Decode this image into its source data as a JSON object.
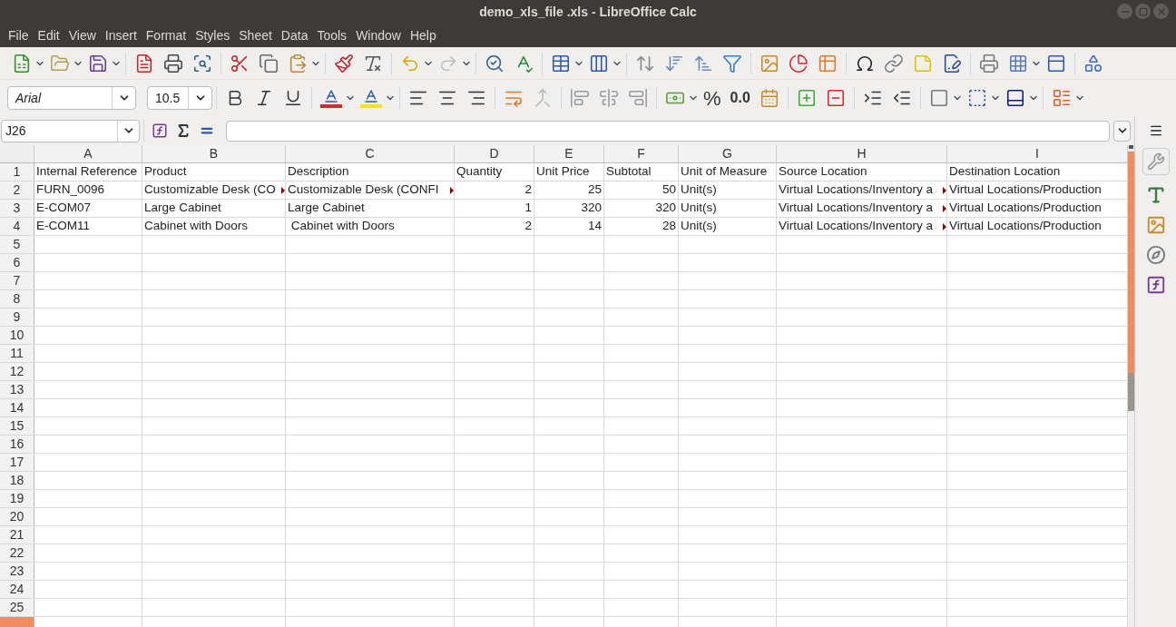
{
  "window": {
    "title": "demo_xls_file .xls - LibreOffice Calc"
  },
  "menu": [
    "File",
    "Edit",
    "View",
    "Insert",
    "Format",
    "Styles",
    "Sheet",
    "Data",
    "Tools",
    "Window",
    "Help"
  ],
  "formatting": {
    "font_name": "Arial",
    "font_size": "10.5",
    "percent_glyph": "%",
    "decimal_glyph": "0.0"
  },
  "formula_bar": {
    "name_box": "J26"
  },
  "columns": [
    "A",
    "B",
    "C",
    "D",
    "E",
    "F",
    "G",
    "H",
    "I"
  ],
  "rows": [
    {
      "number": "1",
      "selected": false,
      "cells": [
        {
          "text": "Internal Reference",
          "kind": "text",
          "clipped": false
        },
        {
          "text": "Product",
          "kind": "text",
          "clipped": false
        },
        {
          "text": "Description",
          "kind": "text",
          "clipped": false
        },
        {
          "text": "Quantity",
          "kind": "text",
          "clipped": false
        },
        {
          "text": "Unit Price",
          "kind": "text",
          "clipped": false
        },
        {
          "text": "Subtotal",
          "kind": "text",
          "clipped": false
        },
        {
          "text": "Unit of Measure",
          "kind": "text",
          "clipped": false
        },
        {
          "text": "Source Location",
          "kind": "text",
          "clipped": false
        },
        {
          "text": "Destination Location",
          "kind": "text",
          "clipped": false
        }
      ]
    },
    {
      "number": "2",
      "selected": false,
      "cells": [
        {
          "text": "FURN_0096",
          "kind": "text",
          "clipped": false
        },
        {
          "text": "Customizable Desk (CO",
          "kind": "text",
          "clipped": true
        },
        {
          "text": "Customizable Desk (CONFI",
          "kind": "text",
          "clipped": true
        },
        {
          "text": "2",
          "kind": "number",
          "clipped": false
        },
        {
          "text": "25",
          "kind": "number",
          "clipped": false
        },
        {
          "text": "50",
          "kind": "number",
          "clipped": false
        },
        {
          "text": "Unit(s)",
          "kind": "text",
          "clipped": false
        },
        {
          "text": "Virtual Locations/Inventory a",
          "kind": "text",
          "clipped": true
        },
        {
          "text": "Virtual Locations/Production",
          "kind": "text",
          "clipped": false
        }
      ]
    },
    {
      "number": "3",
      "selected": false,
      "cells": [
        {
          "text": "E-COM07",
          "kind": "text",
          "clipped": false
        },
        {
          "text": "Large Cabinet",
          "kind": "text",
          "clipped": false
        },
        {
          "text": "Large Cabinet",
          "kind": "text",
          "clipped": false
        },
        {
          "text": "1",
          "kind": "number",
          "clipped": false
        },
        {
          "text": "320",
          "kind": "number",
          "clipped": false
        },
        {
          "text": "320",
          "kind": "number",
          "clipped": false
        },
        {
          "text": "Unit(s)",
          "kind": "text",
          "clipped": false
        },
        {
          "text": "Virtual Locations/Inventory a",
          "kind": "text",
          "clipped": true
        },
        {
          "text": "Virtual Locations/Production",
          "kind": "text",
          "clipped": false
        }
      ]
    },
    {
      "number": "4",
      "selected": false,
      "cells": [
        {
          "text": "E-COM11",
          "kind": "text",
          "clipped": false
        },
        {
          "text": "Cabinet with Doors",
          "kind": "text",
          "clipped": false
        },
        {
          "text": " Cabinet with Doors",
          "kind": "text",
          "clipped": false
        },
        {
          "text": "2",
          "kind": "number",
          "clipped": false
        },
        {
          "text": "14",
          "kind": "number",
          "clipped": false
        },
        {
          "text": "28",
          "kind": "number",
          "clipped": false
        },
        {
          "text": "Unit(s)",
          "kind": "text",
          "clipped": false
        },
        {
          "text": "Virtual Locations/Inventory a",
          "kind": "text",
          "clipped": true
        },
        {
          "text": "Virtual Locations/Production",
          "kind": "text",
          "clipped": false
        }
      ]
    },
    {
      "number": "5",
      "selected": false
    },
    {
      "number": "6",
      "selected": false
    },
    {
      "number": "7",
      "selected": false
    },
    {
      "number": "8",
      "selected": false
    },
    {
      "number": "9",
      "selected": false
    },
    {
      "number": "10",
      "selected": false
    },
    {
      "number": "11",
      "selected": false
    },
    {
      "number": "12",
      "selected": false
    },
    {
      "number": "13",
      "selected": false
    },
    {
      "number": "14",
      "selected": false
    },
    {
      "number": "15",
      "selected": false
    },
    {
      "number": "16",
      "selected": false
    },
    {
      "number": "17",
      "selected": false
    },
    {
      "number": "18",
      "selected": false
    },
    {
      "number": "19",
      "selected": false
    },
    {
      "number": "20",
      "selected": false
    },
    {
      "number": "21",
      "selected": false
    },
    {
      "number": "22",
      "selected": false
    },
    {
      "number": "23",
      "selected": false
    },
    {
      "number": "24",
      "selected": false
    },
    {
      "number": "25",
      "selected": false
    },
    {
      "selected": true
    }
  ]
}
